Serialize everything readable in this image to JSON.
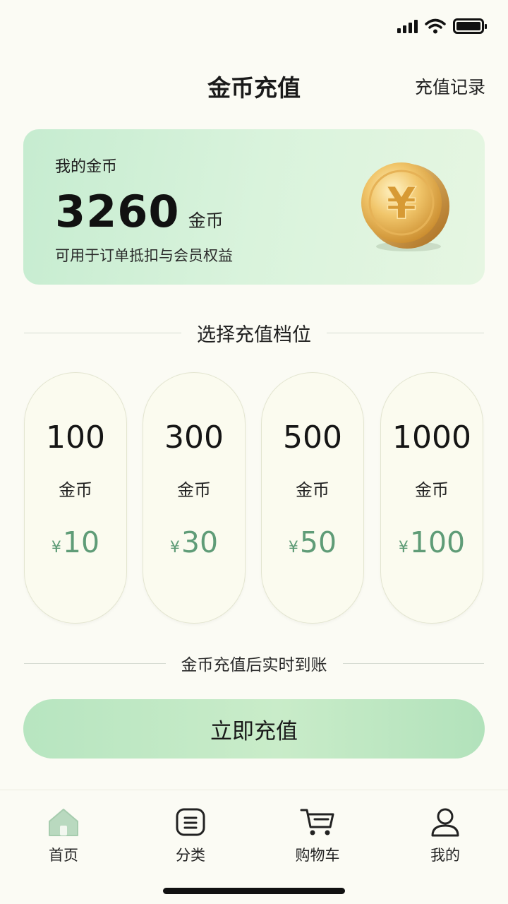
{
  "header": {
    "title": "金币充值",
    "right_action": "充值记录"
  },
  "balance": {
    "label": "我的金币",
    "value": "3260",
    "unit": "金币",
    "description": "可用于订单抵扣与会员权益",
    "coin_symbol": "¥"
  },
  "tiers_section": {
    "title": "选择充值档位"
  },
  "tiers": [
    {
      "coins": "100",
      "unit": "金币",
      "currency": "¥",
      "price": "10"
    },
    {
      "coins": "300",
      "unit": "金币",
      "currency": "¥",
      "price": "30"
    },
    {
      "coins": "500",
      "unit": "金币",
      "currency": "¥",
      "price": "50"
    },
    {
      "coins": "1000",
      "unit": "金币",
      "currency": "¥",
      "price": "100"
    }
  ],
  "note": "金币充值后实时到账",
  "action": {
    "recharge_label": "立即充值"
  },
  "tabbar": {
    "items": [
      {
        "label": "首页",
        "icon": "home-icon",
        "active": true
      },
      {
        "label": "分类",
        "icon": "category-icon",
        "active": false
      },
      {
        "label": "购物车",
        "icon": "cart-icon",
        "active": false
      },
      {
        "label": "我的",
        "icon": "profile-icon",
        "active": false
      }
    ]
  },
  "colors": {
    "accent_green": "#5f9c77",
    "card_green": "#c6ecd0",
    "button_green": "#b7e5c0",
    "background": "#fbfbf4"
  }
}
